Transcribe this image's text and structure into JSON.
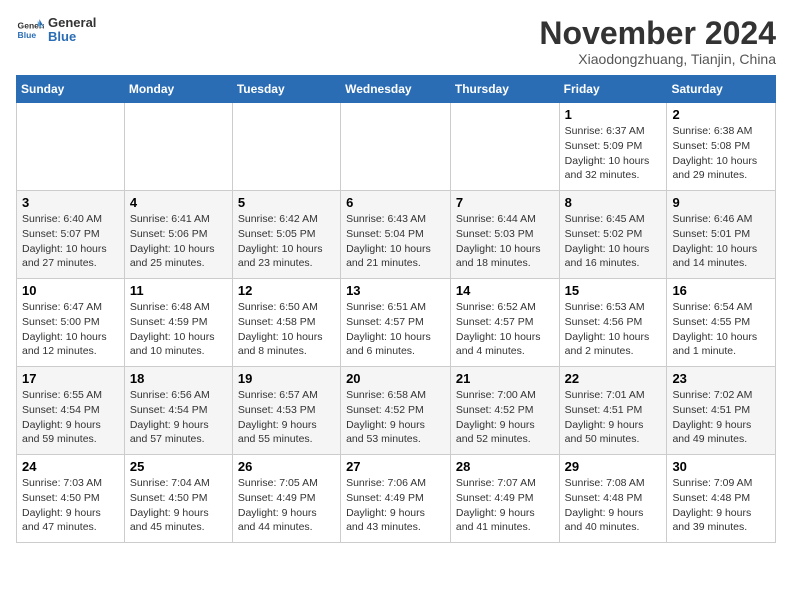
{
  "header": {
    "logo_general": "General",
    "logo_blue": "Blue",
    "month_title": "November 2024",
    "location": "Xiaodongzhuang, Tianjin, China"
  },
  "weekdays": [
    "Sunday",
    "Monday",
    "Tuesday",
    "Wednesday",
    "Thursday",
    "Friday",
    "Saturday"
  ],
  "weeks": [
    [
      {
        "day": "",
        "info": ""
      },
      {
        "day": "",
        "info": ""
      },
      {
        "day": "",
        "info": ""
      },
      {
        "day": "",
        "info": ""
      },
      {
        "day": "",
        "info": ""
      },
      {
        "day": "1",
        "info": "Sunrise: 6:37 AM\nSunset: 5:09 PM\nDaylight: 10 hours\nand 32 minutes."
      },
      {
        "day": "2",
        "info": "Sunrise: 6:38 AM\nSunset: 5:08 PM\nDaylight: 10 hours\nand 29 minutes."
      }
    ],
    [
      {
        "day": "3",
        "info": "Sunrise: 6:40 AM\nSunset: 5:07 PM\nDaylight: 10 hours\nand 27 minutes."
      },
      {
        "day": "4",
        "info": "Sunrise: 6:41 AM\nSunset: 5:06 PM\nDaylight: 10 hours\nand 25 minutes."
      },
      {
        "day": "5",
        "info": "Sunrise: 6:42 AM\nSunset: 5:05 PM\nDaylight: 10 hours\nand 23 minutes."
      },
      {
        "day": "6",
        "info": "Sunrise: 6:43 AM\nSunset: 5:04 PM\nDaylight: 10 hours\nand 21 minutes."
      },
      {
        "day": "7",
        "info": "Sunrise: 6:44 AM\nSunset: 5:03 PM\nDaylight: 10 hours\nand 18 minutes."
      },
      {
        "day": "8",
        "info": "Sunrise: 6:45 AM\nSunset: 5:02 PM\nDaylight: 10 hours\nand 16 minutes."
      },
      {
        "day": "9",
        "info": "Sunrise: 6:46 AM\nSunset: 5:01 PM\nDaylight: 10 hours\nand 14 minutes."
      }
    ],
    [
      {
        "day": "10",
        "info": "Sunrise: 6:47 AM\nSunset: 5:00 PM\nDaylight: 10 hours\nand 12 minutes."
      },
      {
        "day": "11",
        "info": "Sunrise: 6:48 AM\nSunset: 4:59 PM\nDaylight: 10 hours\nand 10 minutes."
      },
      {
        "day": "12",
        "info": "Sunrise: 6:50 AM\nSunset: 4:58 PM\nDaylight: 10 hours\nand 8 minutes."
      },
      {
        "day": "13",
        "info": "Sunrise: 6:51 AM\nSunset: 4:57 PM\nDaylight: 10 hours\nand 6 minutes."
      },
      {
        "day": "14",
        "info": "Sunrise: 6:52 AM\nSunset: 4:57 PM\nDaylight: 10 hours\nand 4 minutes."
      },
      {
        "day": "15",
        "info": "Sunrise: 6:53 AM\nSunset: 4:56 PM\nDaylight: 10 hours\nand 2 minutes."
      },
      {
        "day": "16",
        "info": "Sunrise: 6:54 AM\nSunset: 4:55 PM\nDaylight: 10 hours\nand 1 minute."
      }
    ],
    [
      {
        "day": "17",
        "info": "Sunrise: 6:55 AM\nSunset: 4:54 PM\nDaylight: 9 hours\nand 59 minutes."
      },
      {
        "day": "18",
        "info": "Sunrise: 6:56 AM\nSunset: 4:54 PM\nDaylight: 9 hours\nand 57 minutes."
      },
      {
        "day": "19",
        "info": "Sunrise: 6:57 AM\nSunset: 4:53 PM\nDaylight: 9 hours\nand 55 minutes."
      },
      {
        "day": "20",
        "info": "Sunrise: 6:58 AM\nSunset: 4:52 PM\nDaylight: 9 hours\nand 53 minutes."
      },
      {
        "day": "21",
        "info": "Sunrise: 7:00 AM\nSunset: 4:52 PM\nDaylight: 9 hours\nand 52 minutes."
      },
      {
        "day": "22",
        "info": "Sunrise: 7:01 AM\nSunset: 4:51 PM\nDaylight: 9 hours\nand 50 minutes."
      },
      {
        "day": "23",
        "info": "Sunrise: 7:02 AM\nSunset: 4:51 PM\nDaylight: 9 hours\nand 49 minutes."
      }
    ],
    [
      {
        "day": "24",
        "info": "Sunrise: 7:03 AM\nSunset: 4:50 PM\nDaylight: 9 hours\nand 47 minutes."
      },
      {
        "day": "25",
        "info": "Sunrise: 7:04 AM\nSunset: 4:50 PM\nDaylight: 9 hours\nand 45 minutes."
      },
      {
        "day": "26",
        "info": "Sunrise: 7:05 AM\nSunset: 4:49 PM\nDaylight: 9 hours\nand 44 minutes."
      },
      {
        "day": "27",
        "info": "Sunrise: 7:06 AM\nSunset: 4:49 PM\nDaylight: 9 hours\nand 43 minutes."
      },
      {
        "day": "28",
        "info": "Sunrise: 7:07 AM\nSunset: 4:49 PM\nDaylight: 9 hours\nand 41 minutes."
      },
      {
        "day": "29",
        "info": "Sunrise: 7:08 AM\nSunset: 4:48 PM\nDaylight: 9 hours\nand 40 minutes."
      },
      {
        "day": "30",
        "info": "Sunrise: 7:09 AM\nSunset: 4:48 PM\nDaylight: 9 hours\nand 39 minutes."
      }
    ]
  ]
}
